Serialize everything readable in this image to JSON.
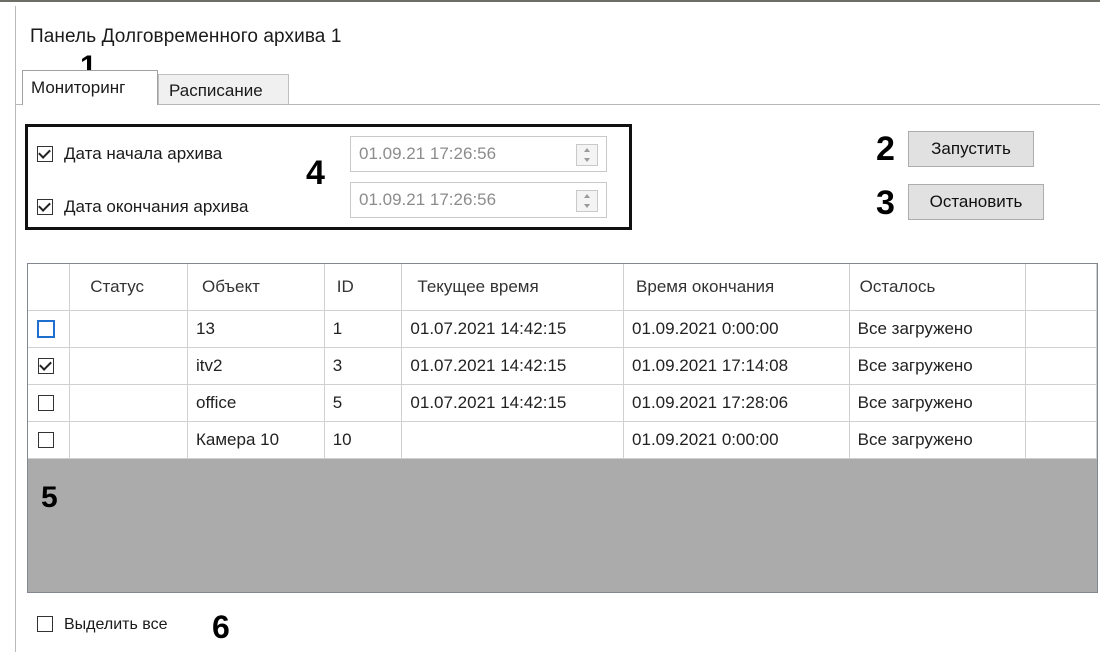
{
  "panel_title": "Панель Долговременного архива 1",
  "tabs": [
    {
      "label": "Мониторинг",
      "active": true
    },
    {
      "label": "Расписание",
      "active": false
    }
  ],
  "markers": {
    "m1": "1",
    "m2": "2",
    "m3": "3",
    "m4": "4",
    "m5": "5",
    "m6": "6"
  },
  "range": {
    "start": {
      "label": "Дата начала архива",
      "checked": true,
      "value": "01.09.21 17:26:56"
    },
    "end": {
      "label": "Дата окончания архива",
      "checked": true,
      "value": "01.09.21 17:26:56"
    }
  },
  "buttons": {
    "start": "Запустить",
    "stop": "Остановить"
  },
  "table": {
    "columns": [
      "",
      "Статус",
      "Объект",
      "ID",
      "Текущее время",
      "Время окончания",
      "Осталось",
      ""
    ],
    "rows": [
      {
        "checked": false,
        "focused": true,
        "status": "",
        "object": "13",
        "id": "1",
        "current": "01.07.2021 14:42:15",
        "end": "01.09.2021 0:00:00",
        "remaining": "Все загружено"
      },
      {
        "checked": true,
        "focused": false,
        "status": "",
        "object": "itv2",
        "id": "3",
        "current": "01.07.2021 14:42:15",
        "end": "01.09.2021 17:14:08",
        "remaining": "Все загружено"
      },
      {
        "checked": false,
        "focused": false,
        "status": "",
        "object": "office",
        "id": "5",
        "current": "01.07.2021 14:42:15",
        "end": "01.09.2021 17:28:06",
        "remaining": "Все загружено"
      },
      {
        "checked": false,
        "focused": false,
        "status": "",
        "object": "Камера 10",
        "id": "10",
        "current": "",
        "end": "01.09.2021 0:00:00",
        "remaining": "Все загружено"
      }
    ]
  },
  "select_all": {
    "label": "Выделить все",
    "checked": false
  }
}
